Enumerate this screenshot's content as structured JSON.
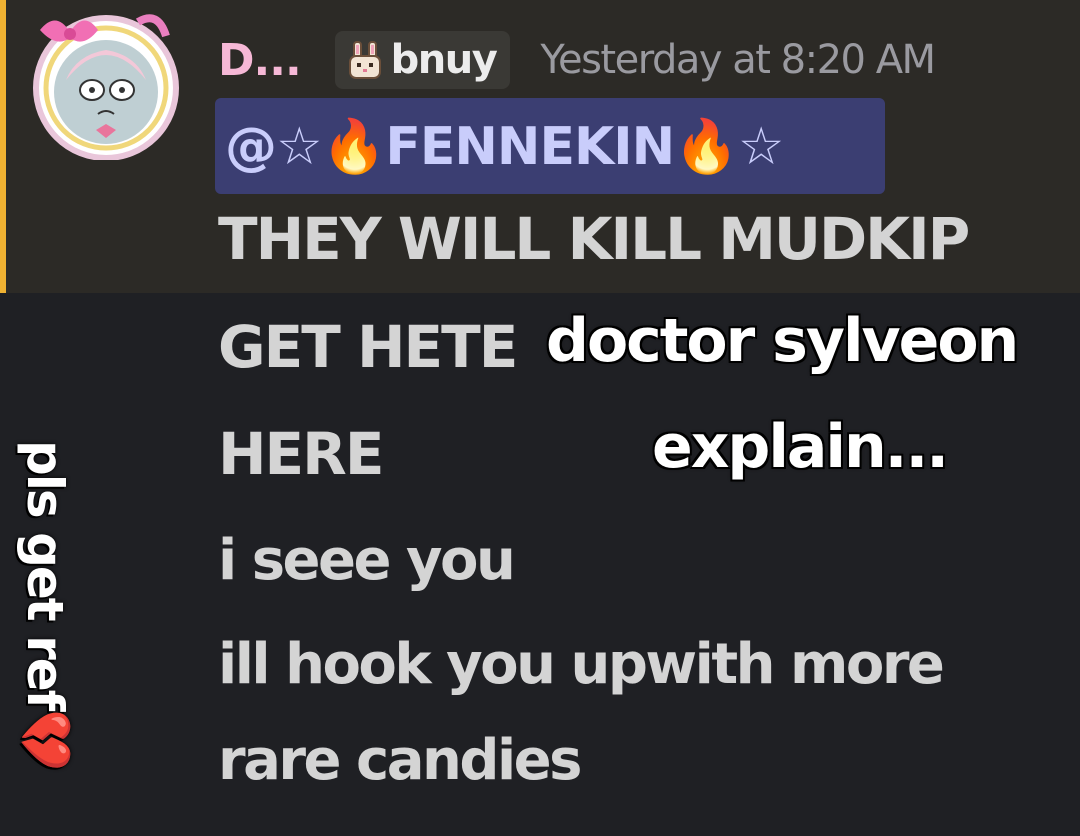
{
  "message": {
    "author": "D...",
    "tag": {
      "icon": "bunny-icon",
      "label": "bnuy"
    },
    "timestamp": "Yesterday at 8:20 AM",
    "mention": "@☆🔥FENNEKIN🔥☆",
    "lines": [
      "THEY WILL KILL MUDKIP",
      "GET HETE",
      "HERE",
      "i seee you",
      "ill hook you upwith more",
      "rare candies"
    ]
  },
  "overlay": {
    "caption_line1": "doctor sylveon",
    "caption_line2": "explain...",
    "side_caption": "pls get ref💔"
  },
  "colors": {
    "background": "#1f2024",
    "highlight_band": "#2c2a26",
    "mention_bar": "#f0b232",
    "author": "#f6b8d6",
    "mention_pill": "#3b3e72",
    "mention_text": "#c9cdfb",
    "message_text": "#d4d4d4",
    "timestamp": "#9a9aa0"
  }
}
